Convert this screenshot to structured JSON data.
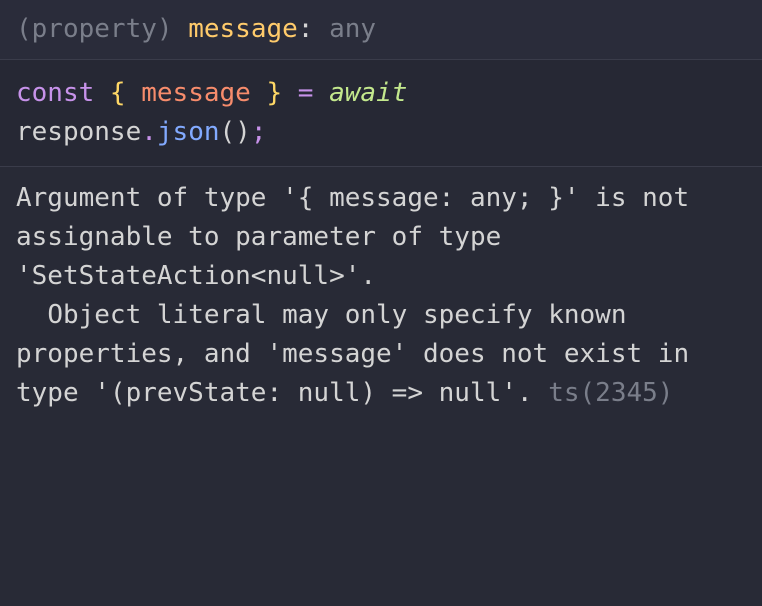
{
  "signature": {
    "kind": "(property)",
    "name": "message",
    "colon": ":",
    "type": "any"
  },
  "code": {
    "const_kw": "const",
    "open_brace": " { ",
    "var": "message",
    "close_brace": " } ",
    "equals": "= ",
    "await_kw": "await",
    "obj": "response",
    "dot": ".",
    "method": "json",
    "parens": "()",
    "semi": ";"
  },
  "error": {
    "line1": "Argument of type '{ message: any; }' is not assignable to parameter of type 'SetStateAction<null>'.",
    "line2": "  Object literal may only specify known properties, and 'message' does not exist in type '(prevState: null) => null'.",
    "code_label": "ts(2345)"
  }
}
